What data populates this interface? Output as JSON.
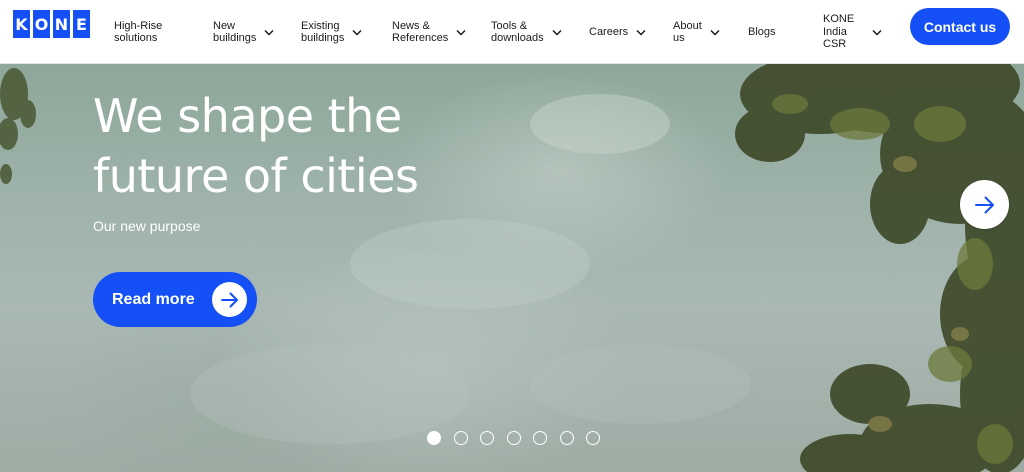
{
  "brand": {
    "logo_letters": [
      "K",
      "O",
      "N",
      "E"
    ],
    "color": "#1450f5"
  },
  "nav": {
    "items": [
      {
        "label": "High-Rise\nsolutions",
        "has_dropdown": false
      },
      {
        "label": "New\nbuildings",
        "has_dropdown": true
      },
      {
        "label": "Existing\nbuildings",
        "has_dropdown": true
      },
      {
        "label": "News &\nReferences",
        "has_dropdown": true
      },
      {
        "label": "Tools &\ndownloads",
        "has_dropdown": true
      },
      {
        "label": "Careers",
        "has_dropdown": true
      },
      {
        "label": "About\nus",
        "has_dropdown": true
      },
      {
        "label": "Blogs",
        "has_dropdown": false
      },
      {
        "label": "KONE\nIndia\nCSR",
        "has_dropdown": true
      }
    ],
    "contact_label": "Contact us",
    "chevron_icon": "chevron-down-icon"
  },
  "hero": {
    "title": "We shape the future of cities",
    "subtitle": "Our new purpose",
    "cta_label": "Read more",
    "cta_icon": "arrow-right-icon",
    "next_icon": "arrow-right-icon",
    "slide_count": 7,
    "active_slide": 1
  }
}
